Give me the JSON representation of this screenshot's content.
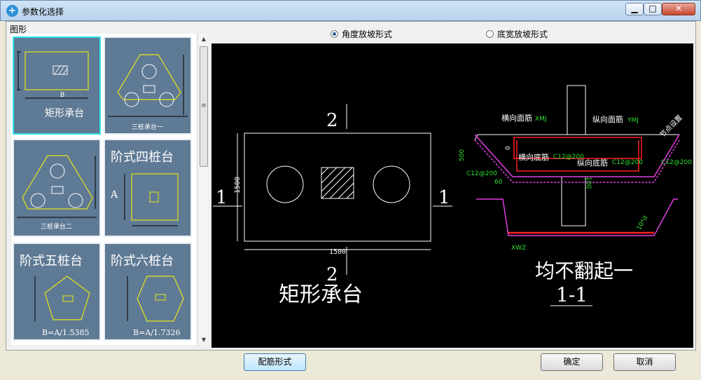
{
  "window": {
    "title": "参数化选择",
    "min_glyph": "▁",
    "max_glyph": "□",
    "close_glyph": "✕",
    "icon_glyph": "+"
  },
  "shapes_panel": {
    "label": "图形",
    "thumbnails": [
      {
        "caption": "矩形承台",
        "sub": "B"
      },
      {
        "caption": "三桩承台一",
        "sub": ""
      },
      {
        "caption": "三桩承台二",
        "sub": ""
      },
      {
        "caption": "阶式四桩台",
        "sub": "A"
      },
      {
        "caption": "阶式五桩台",
        "sub": "B=A/1.5385"
      },
      {
        "caption": "阶式六桩台",
        "sub": "B=A/1.7326"
      }
    ],
    "scroll": {
      "up": "▲",
      "down": "▼",
      "grip": "≡"
    }
  },
  "options": {
    "slope_angle": {
      "label": "角度放坡形式",
      "selected": true
    },
    "slope_width": {
      "label": "底宽放坡形式",
      "selected": false
    }
  },
  "preview": {
    "plan_title": "矩形承台",
    "section_mark": "2",
    "section_mark_side": "1",
    "width_dim": "1500",
    "height_dim": "1500",
    "section_title": "均不翻起一",
    "section_name": "1-1",
    "labels": {
      "top_transverse": "横向面筋",
      "top_transverse_code": "XMJ",
      "top_longitudinal": "纵向面筋",
      "top_longitudinal_code": "YMJ",
      "bottom_transverse": "横向底筋",
      "bottom_longitudinal": "纵向底筋",
      "rebar_spec": "C12@200",
      "depth": "500",
      "cover": "100",
      "angle": "60",
      "zero": "0",
      "anchor_text": "节点设置",
      "tenxd": "10*d",
      "xwz": "XWZ"
    }
  },
  "buttons": {
    "rebar_form": "配筋形式",
    "ok": "确定",
    "cancel": "取消"
  },
  "colors": {
    "preview_bg": "#000000",
    "thumb_bg": "#5f7a94",
    "thumb_line": "#e6e61a",
    "rebar_red": "#ff2020",
    "magenta": "#e040e0",
    "dim_green": "#30e030",
    "selected_border": "#2ee3e8"
  }
}
